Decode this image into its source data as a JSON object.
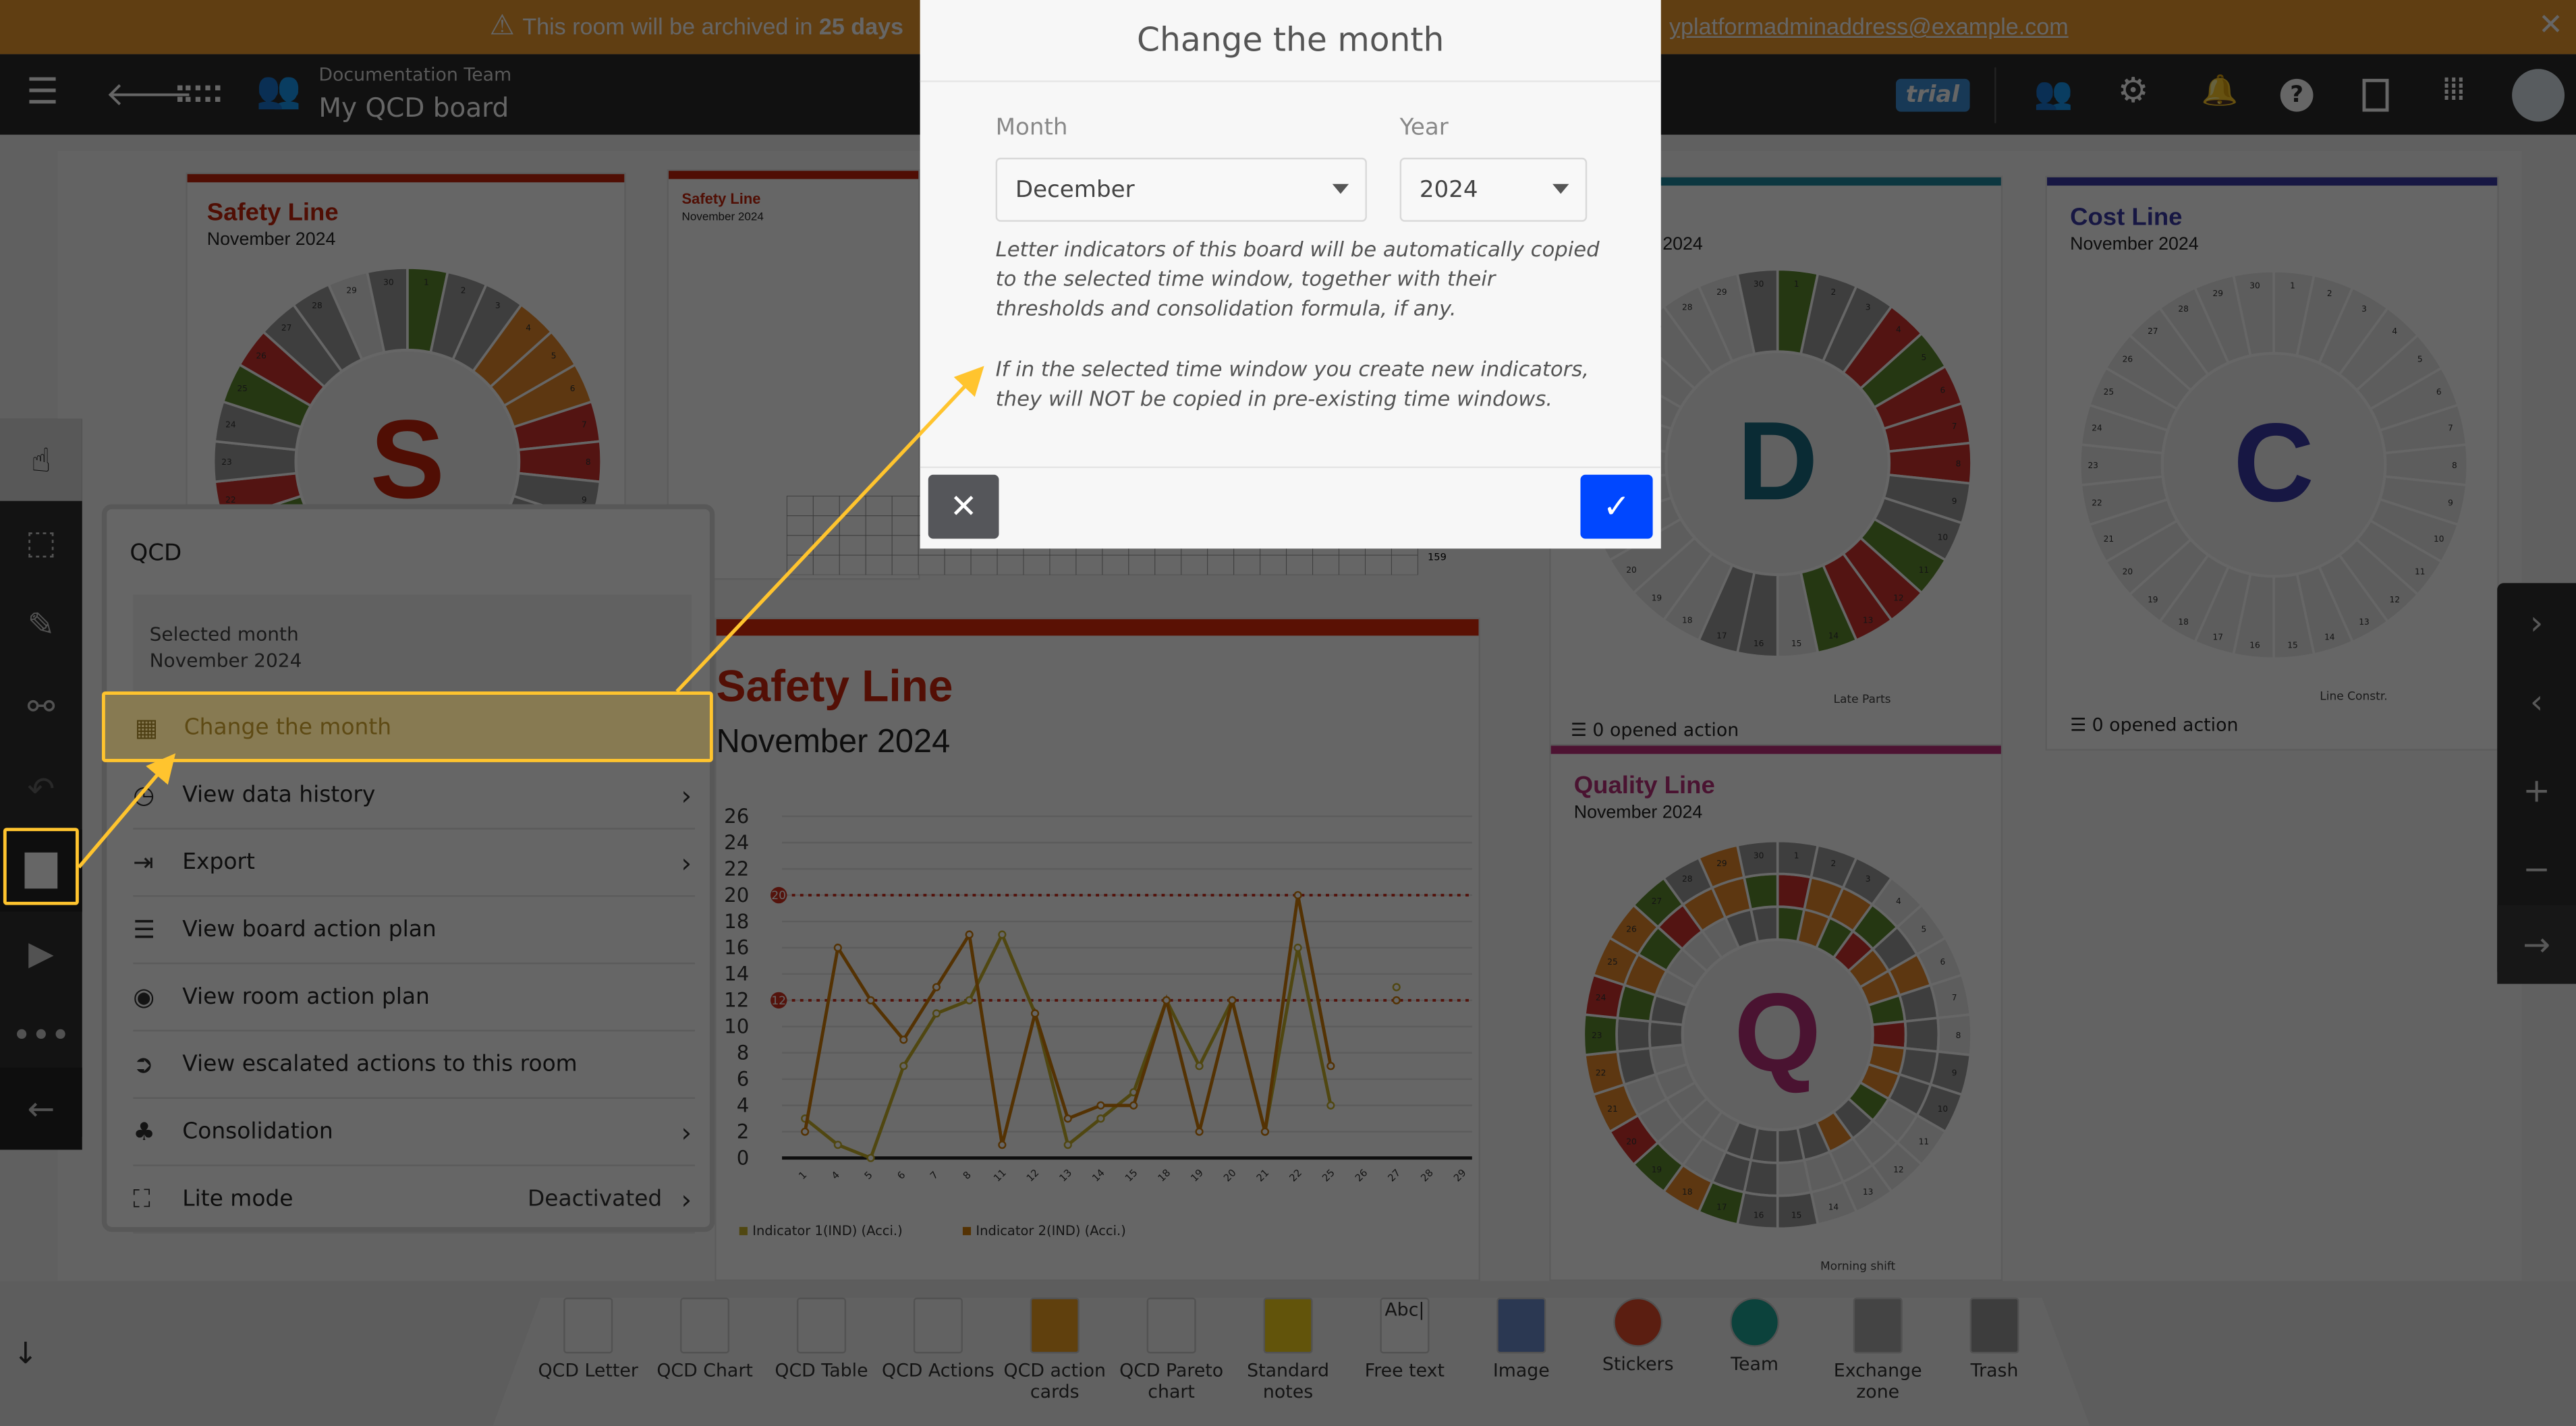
{
  "banner": {
    "text_left": "This room will be archived in",
    "days": "25 days",
    "text_right": "yplatformadminaddress@example.com",
    "icon": "warning-icon",
    "color": "#f09a2e"
  },
  "header": {
    "team": "Documentation Team",
    "board": "My QCD board",
    "badge": "trial",
    "icons": [
      "menu-icon",
      "back-icon",
      "board-layout-icon",
      "team-icon",
      "users-icon",
      "gear-icon",
      "bell-icon",
      "help-icon",
      "book-icon",
      "apps-grid-icon",
      "avatar"
    ]
  },
  "cards": {
    "safety1": {
      "title": "Safety Line",
      "month": "November 2024",
      "letter": "S",
      "color": "#c8240a"
    },
    "safety_small": {
      "title": "Safety Line",
      "month": "November 2024",
      "total": "159"
    },
    "delivery": {
      "month": "2024",
      "letter": "D",
      "color": "#1a6b82",
      "legend": "Late Parts",
      "actions": "0 opened action"
    },
    "cost": {
      "title": "Cost Line",
      "month": "November 2024",
      "letter": "C",
      "color": "#3a3aa8",
      "legend": "Line Constr.",
      "actions": "0 opened action"
    },
    "quality": {
      "title": "Quality Line",
      "month": "November 2024",
      "letter": "Q",
      "color": "#b8307a",
      "legend": "Morning shift"
    },
    "chart": {
      "title": "Safety Line",
      "month": "November 2024"
    }
  },
  "chart_data": {
    "type": "line",
    "title": "Safety Line",
    "subtitle": "November 2024",
    "categories": [
      "1",
      "4",
      "5",
      "6",
      "7",
      "8",
      "11",
      "12",
      "13",
      "14",
      "15",
      "18",
      "19",
      "20",
      "21",
      "22",
      "25",
      "26",
      "27",
      "28",
      "29"
    ],
    "series": [
      {
        "name": "Indicator 1(IND) (Acci.)",
        "color": "#c9b22a",
        "values": [
          3,
          1,
          0,
          7,
          11,
          12,
          17,
          11,
          1,
          3,
          5,
          12,
          7,
          12,
          2,
          16,
          4,
          null,
          13,
          null,
          null
        ]
      },
      {
        "name": "Indicator 2(IND) (Acci.)",
        "color": "#d27c08",
        "values": [
          2,
          16,
          12,
          9,
          13,
          17,
          1,
          11,
          3,
          4,
          4,
          12,
          2,
          12,
          2,
          20,
          7,
          null,
          12,
          null,
          null
        ]
      }
    ],
    "thresholds": [
      20,
      12
    ],
    "ylim": [
      0,
      26
    ],
    "yticks": [
      0,
      2,
      4,
      6,
      8,
      10,
      12,
      14,
      16,
      18,
      20,
      22,
      24,
      26
    ],
    "grid": true,
    "legend": "bottom"
  },
  "menu": {
    "title": "QCD",
    "selected_label": "Selected month",
    "selected_value": "November 2024",
    "items": [
      {
        "label": "Change the month",
        "icon": "calendar-icon",
        "chev": ""
      },
      {
        "label": "View data history",
        "icon": "history-icon",
        "chev": "›"
      },
      {
        "label": "Export",
        "icon": "export-icon",
        "chev": "›"
      },
      {
        "label": "View board action plan",
        "icon": "list-icon",
        "chev": ""
      },
      {
        "label": "View room action plan",
        "icon": "room-plan-icon",
        "chev": ""
      },
      {
        "label": "View escalated actions to this room",
        "icon": "escalate-icon",
        "chev": ""
      },
      {
        "label": "Consolidation",
        "icon": "hierarchy-icon",
        "chev": "›"
      },
      {
        "label": "Lite mode",
        "icon": "lite-mode-icon",
        "chev": "›",
        "value": "Deactivated"
      }
    ]
  },
  "modal": {
    "title": "Change the month",
    "month_label": "Month",
    "month_value": "December",
    "year_label": "Year",
    "year_value": "2024",
    "note1": "Letter indicators of this board will be automatically copied to the selected time window, together with their thresholds and consolidation formula, if any.",
    "note2": "If in the selected time window you create new indicators, they will NOT be copied in pre-existing time windows.",
    "cancel_icon": "close-icon",
    "confirm_icon": "check-icon",
    "confirm_color": "#0047ff"
  },
  "toolbar": {
    "items": [
      {
        "label": "QCD Letter",
        "color": "#f5f5f5"
      },
      {
        "label": "QCD Chart",
        "color": "#f5f5f5"
      },
      {
        "label": "QCD Table",
        "color": "#f5f5f5"
      },
      {
        "label": "QCD Actions",
        "color": "#f5f5f5"
      },
      {
        "label": "QCD action cards",
        "color": "#f0a020"
      },
      {
        "label": "QCD Pareto chart",
        "color": "#f5f5f5"
      },
      {
        "label": "Standard notes",
        "color": "#f4d11b"
      },
      {
        "label": "Free text",
        "color": "#fafafa"
      },
      {
        "label": "Image",
        "color": "#6b8ccc"
      },
      {
        "label": "Stickers",
        "color": "#e34a2a"
      },
      {
        "label": "Team",
        "color": "#1fa596"
      },
      {
        "label": "Exchange zone",
        "color": "#aaaaaa"
      },
      {
        "label": "Trash",
        "color": "#999999"
      }
    ],
    "free_text_sample": "Abc|"
  }
}
